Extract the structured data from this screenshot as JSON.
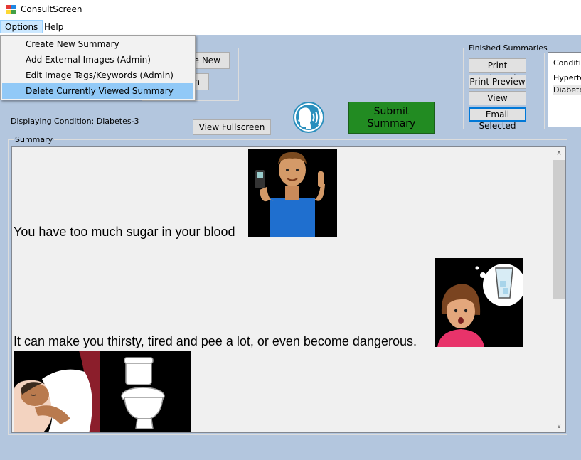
{
  "window": {
    "title": "ConsultScreen"
  },
  "menu": {
    "items": [
      "Options",
      "Help"
    ],
    "options_dropdown": [
      "Create New Summary",
      "Add External Images (Admin)",
      "Edit Image Tags/Keywords (Admin)",
      "Delete Currently Viewed Summary"
    ]
  },
  "left_buttons": {
    "new_label": "e New",
    "second_label": "n"
  },
  "status": {
    "displaying": "Displaying Condition: Diabetes-3"
  },
  "view_fullscreen_label": "View Fullscreen",
  "submit_label": "Submit Summary",
  "finished": {
    "legend": "Finished Summaries",
    "print_selected": "Print Selected",
    "print_preview": "Print Preview",
    "view_selected": "View Selected",
    "email_selected": "Email Selected"
  },
  "conditions": {
    "header": "Condition",
    "items": [
      "Hyperten",
      "Diabetes"
    ]
  },
  "summary": {
    "legend": "Summary",
    "lines": [
      "You have too much sugar in your blood",
      "It can make you thirsty, tired and pee a lot, or even become dangerous."
    ]
  },
  "colors": {
    "accent_green": "#228b22",
    "highlight": "#91c9f7",
    "background": "#b3c6de"
  }
}
